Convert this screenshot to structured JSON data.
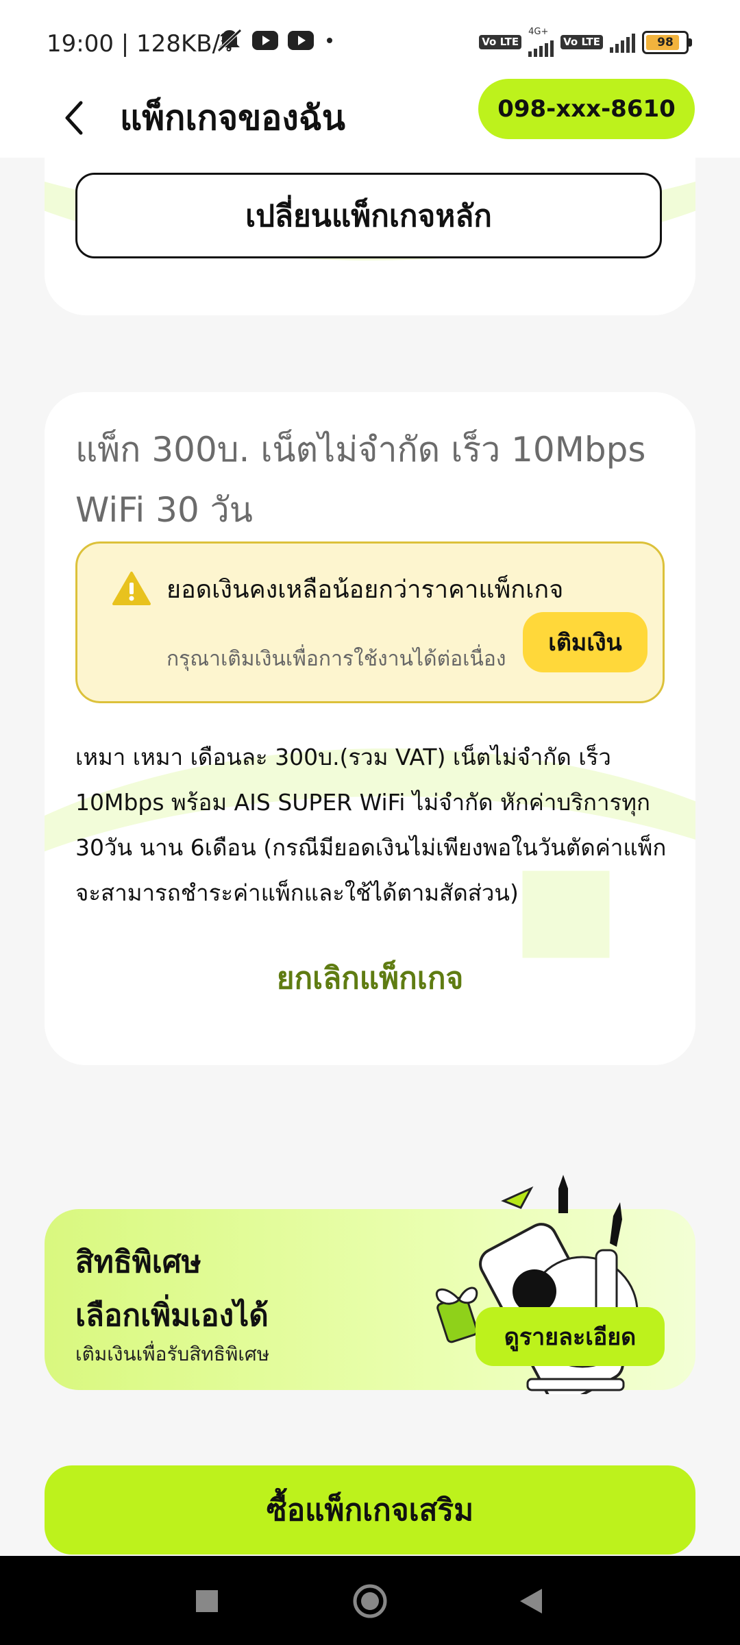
{
  "status": {
    "time_text": "19:00 | 128KB/วิ",
    "battery": "98",
    "network": "4G+",
    "volte": "Vo LTE"
  },
  "header": {
    "title": "แพ็กเกจของฉัน",
    "phone": "098-xxx-8610"
  },
  "card_main": {
    "change_button": "เปลี่ยนแพ็กเกจหลัก"
  },
  "package": {
    "title": "แพ็ก 300บ. เน็ตไม่จำกัด เร็ว 10Mbps WiFi 30 วัน",
    "warning_title": "ยอดเงินคงเหลือน้อยกว่าราคาแพ็กเกจ",
    "warning_sub": "กรุณาเติมเงินเพื่อการใช้งานได้ต่อเนื่อง",
    "topup_button": "เติมเงิน",
    "description": "เหมา เหมา เดือนละ 300บ.(รวม VAT) เน็ตไม่จำกัด เร็ว 10Mbps พร้อม AIS SUPER WiFi ไม่จำกัด หักค่าบริการทุก 30วัน นาน 6เดือน (กรณีมียอดเงินไม่เพียงพอในวันตัดค่าแพ็ก จะสามารถชำระค่าแพ็กและใช้ได้ตามสัดส่วน)",
    "cancel_link": "ยกเลิกแพ็กเกจ"
  },
  "promo": {
    "title_line1": "สิทธิพิเศษ",
    "title_line2": "เลือกเพิ่มเองได้",
    "subtitle": "เติมเงินเพื่อรับสิทธิพิเศษ",
    "detail_button": "ดูรายละเอียด"
  },
  "buy_button": "ซื้อแพ็กเกจเสริม",
  "colors": {
    "accent": "#bdf21c",
    "warning_bg": "#fdf5cf",
    "warning_border": "#dcc13a",
    "topup": "#ffd83a",
    "link": "#5f7c12"
  }
}
